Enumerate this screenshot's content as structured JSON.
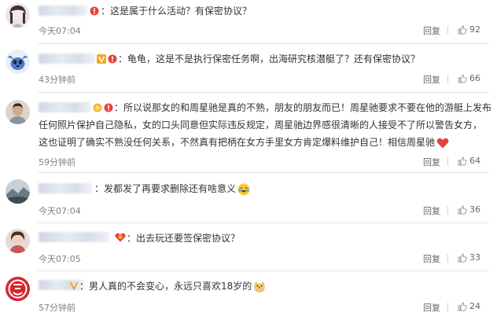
{
  "comments": [
    {
      "text": "这是属于什么活动？有保密协议？",
      "time": "今天07:04",
      "reply": "回复",
      "likes": "92",
      "badge": "red-exclamation-badge",
      "avatar": "anime-girl-avatar"
    },
    {
      "text": "龟龟，这是不是执行保密任务啊，出海研究核潜艇了？还有保密协议？",
      "time": "43分钟前",
      "reply": "回复",
      "likes": "66",
      "badge": "vip-v-badge",
      "avatar": "stitch-avatar"
    },
    {
      "lines": [
        "所以说那女的和周星驰是真的不熟，朋友的朋友而已！周星驰要求不要在他的游艇上发布",
        "任何照片保护自己隐私，女的口头同意但实际违反规定，周星驰边界感很清晰的人接受不了所以警告女方，",
        "这也证明了确实不熟没任何关系，不然真有把柄在女方手里女方肯定爆料维护自己！相信周星驰"
      ],
      "time": "59分钟前",
      "reply": "回复",
      "likes": "64",
      "badge": "gold-member-badge",
      "avatar": "man-avatar",
      "trailing_emoji": "red-heart-icon"
    },
    {
      "text": "发都发了再要求删除还有啥意义",
      "time": "今天07:04",
      "reply": "回复",
      "likes": "36",
      "avatar": "landscape-avatar",
      "trailing_emoji": "laughing-crying-emoji"
    },
    {
      "text": "出去玩还要签保密协议？",
      "time": "今天07:05",
      "reply": "回复",
      "likes": "33",
      "badge": "gold-heart-badge",
      "avatar": "woman-avatar"
    },
    {
      "text": "男人真的不会变心，永远只喜欢18岁的",
      "time": "57分钟前",
      "reply": "回复",
      "likes": "24",
      "badge": "yellow-v-badge",
      "avatar": "red-logo-avatar",
      "trailing_emoji": "doge-emoji"
    }
  ],
  "separator": "：",
  "colors": {
    "like_icon": "#999999",
    "text": "#333333",
    "meta": "#808080",
    "heart": "#e8413c",
    "vip_badge": "#f5a623"
  }
}
